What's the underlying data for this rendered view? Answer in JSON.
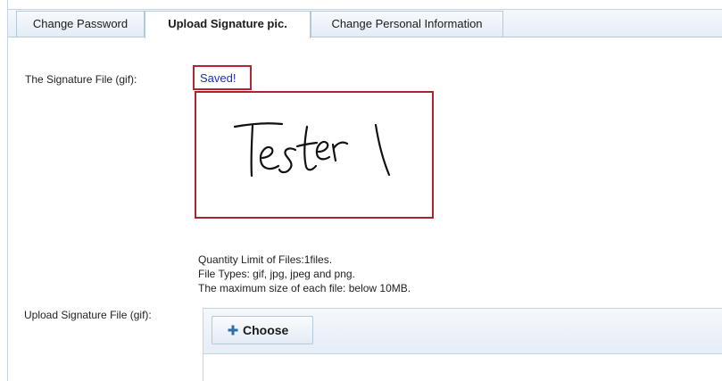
{
  "tabs": [
    {
      "label": "Change Password"
    },
    {
      "label": "Upload Signature pic."
    },
    {
      "label": "Change Personal Information"
    }
  ],
  "signature": {
    "label": "The Signature File (gif):",
    "status": "Saved!",
    "image_text": "Tester1"
  },
  "upload": {
    "limits": [
      "Quantity Limit of Files:1files.",
      "File Types: gif, jpg, jpeg and png.",
      "The maximum size of each file: below 10MB."
    ],
    "label": "Upload Signature File (gif):",
    "choose_label": "Choose",
    "choose_icon": "plus-icon"
  },
  "colors": {
    "highlight_border": "#b3262e",
    "saved_text": "#1a2fb8",
    "plus_icon": "#2d6fa8"
  }
}
